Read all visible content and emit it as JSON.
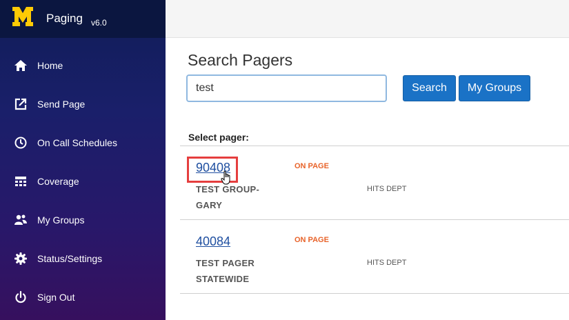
{
  "brand": {
    "logo_letter": "M",
    "name": "Paging",
    "version": "v6.0"
  },
  "nav": [
    {
      "label": "Home",
      "icon": "home-icon"
    },
    {
      "label": "Send Page",
      "icon": "send-page-icon"
    },
    {
      "label": "On Call Schedules",
      "icon": "clock-icon"
    },
    {
      "label": "Coverage",
      "icon": "calendar-icon"
    },
    {
      "label": "My Groups",
      "icon": "users-icon"
    },
    {
      "label": "Status/Settings",
      "icon": "gear-icon"
    },
    {
      "label": "Sign Out",
      "icon": "power-icon"
    }
  ],
  "main": {
    "title": "Search Pagers",
    "search": {
      "value": "test",
      "placeholder": ""
    },
    "search_button": "Search",
    "groups_button": "My Groups",
    "select_label": "Select pager:",
    "pagers": [
      {
        "number": "90408",
        "status": "ON PAGE",
        "name_line1": "TEST GROUP-",
        "name_line2": "GARY",
        "dept": "HITS DEPT"
      },
      {
        "number": "40084",
        "status": "ON PAGE",
        "name_line1": "TEST PAGER",
        "name_line2": "STATEWIDE",
        "dept": "HITS DEPT"
      }
    ]
  },
  "colors": {
    "accent": "#1a72c6",
    "status": "#e8632a",
    "brand_yellow": "#ffcb05",
    "highlight": "#e53e3e"
  }
}
